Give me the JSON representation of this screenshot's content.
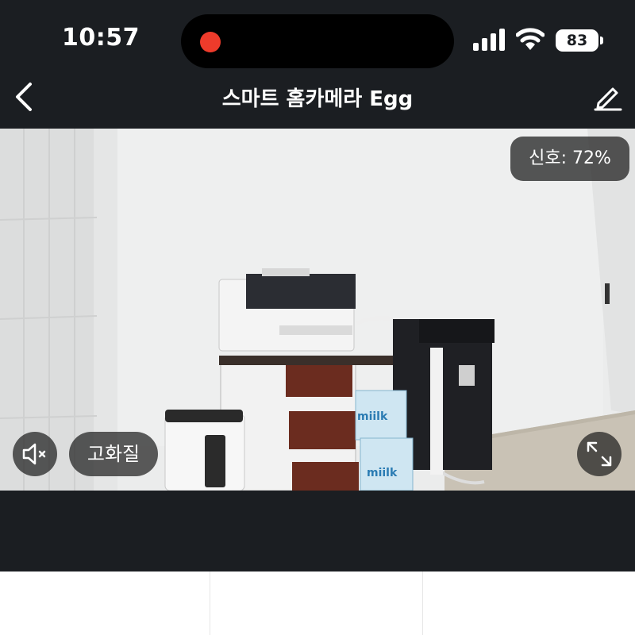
{
  "status_bar": {
    "time": "10:57",
    "recording_indicator_color": "#ee3b2b",
    "signal_icon": "cellular-signal-icon",
    "wifi_icon": "wifi-icon",
    "battery_level": "83"
  },
  "nav": {
    "back_icon": "chevron-left-icon",
    "title": "스마트 홈카메라 Egg",
    "edit_icon": "pencil-icon"
  },
  "camera": {
    "signal_label": "신호: 72%",
    "mute_icon": "speaker-muted-icon",
    "quality_label": "고화질",
    "fullscreen_icon": "expand-icon",
    "box_labels": [
      "miilk",
      "miilk"
    ]
  },
  "colors": {
    "background_dark": "#1b1e22",
    "overlay": "#282828"
  }
}
